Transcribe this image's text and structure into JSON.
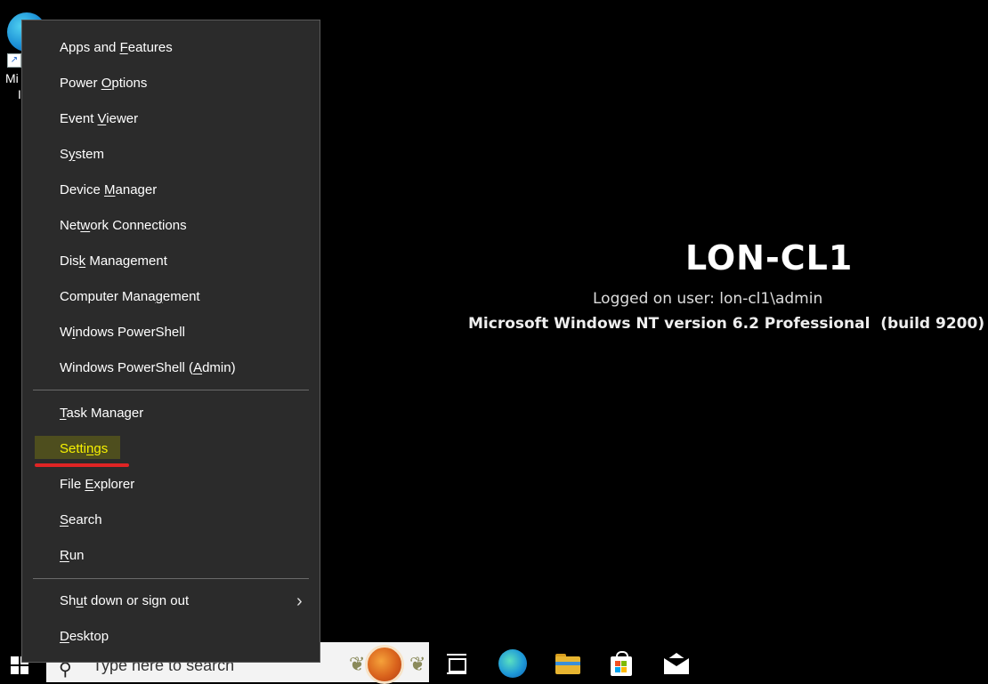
{
  "desktop": {
    "icon_label_line1": "Mi",
    "icon_label_line2": "I"
  },
  "bginfo": {
    "hostname": "LON-CL1",
    "logged_on": "Logged on user: lon-cl1\\admin",
    "os_version": "Microsoft Windows NT version 6.2 Professional  (build 9200)"
  },
  "menu": {
    "items": [
      {
        "label": "Apps and Features",
        "access_key": "F"
      },
      {
        "label": "Power Options",
        "access_key": "O"
      },
      {
        "label": "Event Viewer",
        "access_key": "V"
      },
      {
        "label": "System",
        "access_key": "y"
      },
      {
        "label": "Device Manager",
        "access_key": "M"
      },
      {
        "label": "Network Connections",
        "access_key": "w"
      },
      {
        "label": "Disk Management",
        "access_key": "k"
      },
      {
        "label": "Computer Management",
        "access_key": "g"
      },
      {
        "label": "Windows PowerShell",
        "access_key": "i"
      },
      {
        "label": "Windows PowerShell (Admin)",
        "access_key": "A"
      },
      {
        "label": "Task Manager",
        "access_key": "T"
      },
      {
        "label": "Settings",
        "access_key": "n"
      },
      {
        "label": "File Explorer",
        "access_key": "E"
      },
      {
        "label": "Search",
        "access_key": "S"
      },
      {
        "label": "Run",
        "access_key": "R"
      },
      {
        "label": "Shut down or sign out",
        "access_key": "u"
      },
      {
        "label": "Desktop",
        "access_key": "D"
      }
    ],
    "highlighted_item": "Settings",
    "highlight_color": "#f7f200",
    "annotation_color": "#e02424"
  },
  "taskbar": {
    "search_placeholder": "Type here to search",
    "icons": [
      "start-icon",
      "search-icon",
      "task-view-icon",
      "edge-icon",
      "file-explorer-icon",
      "store-icon",
      "mail-icon"
    ]
  }
}
